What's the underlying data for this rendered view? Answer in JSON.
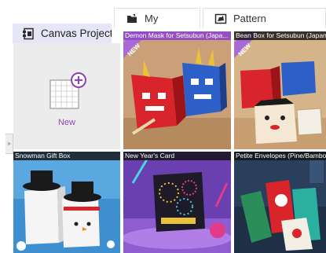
{
  "tabs": {
    "my": {
      "label": "My",
      "icon": "folder-icon"
    },
    "pattern": {
      "label": "Pattern",
      "icon": "pattern-icon"
    },
    "canvas": {
      "label": "Canvas Project",
      "icon": "canvas-project-icon"
    }
  },
  "new_tile": {
    "label": "New",
    "icon": "new-canvas-plus-icon"
  },
  "ribbon_label": "NEW",
  "grid": [
    {
      "title": "Demon Mask for Setsubun (Japa...",
      "is_new": true
    },
    {
      "title": "Bean Box for Setsubun (Japane",
      "is_new": true
    },
    {
      "title": "Snowman Gift Box",
      "is_new": false
    },
    {
      "title": "New Year's Card",
      "is_new": false
    },
    {
      "title": "Petite Envelopes (Pine/Bambo",
      "is_new": false
    }
  ],
  "colors": {
    "accent": "#8e44ad",
    "canvas_tab_bg": "#e6e6f6",
    "ribbon": "#a86ad6",
    "title_bar": "#1c1c1c"
  }
}
